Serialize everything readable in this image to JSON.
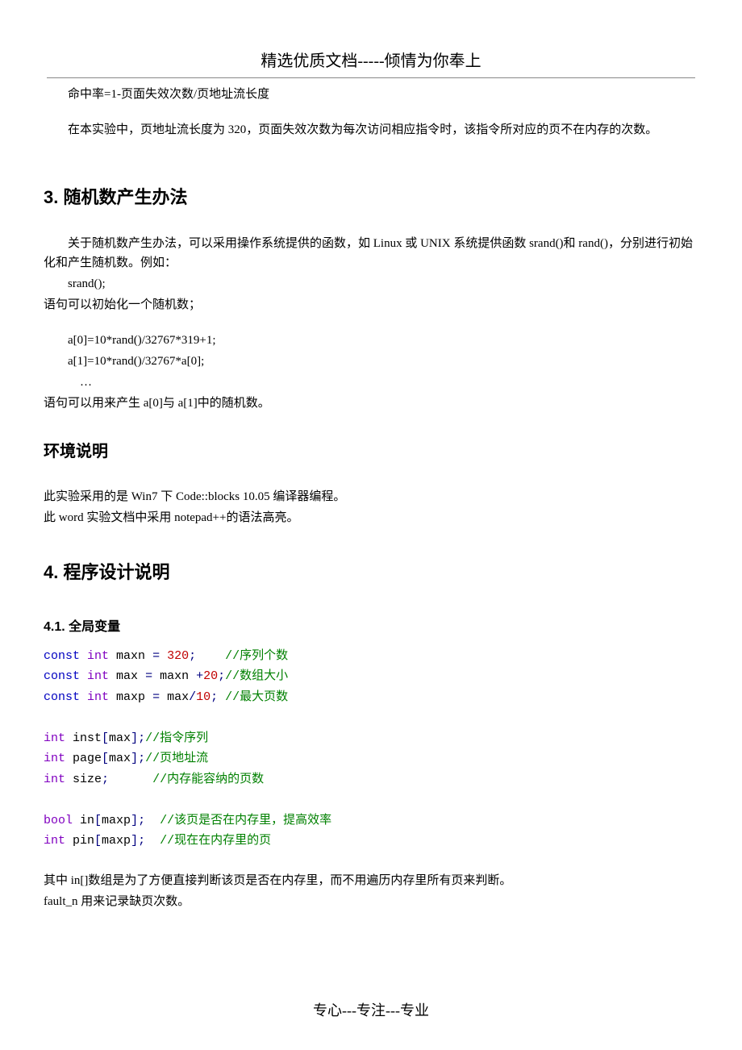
{
  "header": {
    "title": "精选优质文档-----倾情为你奉上"
  },
  "body": {
    "p1": "命中率=1-页面失效次数/页地址流长度",
    "p2": "在本实验中，页地址流长度为 320，页面失效次数为每次访问相应指令时，该指令所对应的页不在内存的次数。",
    "h2_3": "3. 随机数产生办法",
    "p3": "关于随机数产生办法，可以采用操作系统提供的函数，如 Linux 或 UNIX 系统提供函数 srand()和 rand()，分别进行初始化和产生随机数。例如：",
    "p4": "srand();",
    "p5": "语句可以初始化一个随机数；",
    "p6": "a[0]=10*rand()/32767*319+1;",
    "p7": "a[1]=10*rand()/32767*a[0];",
    "p8": "…",
    "p9": "语句可以用来产生 a[0]与 a[1]中的随机数。",
    "h3_env": "环境说明",
    "p10": "此实验采用的是 Win7 下 Code::blocks 10.05 编译器编程。",
    "p11": "此 word 实验文档中采用 notepad++的语法高亮。",
    "h2_4": "4. 程序设计说明",
    "h4_41": "4.1. 全局变量",
    "code": {
      "l1": {
        "kw1": "const",
        "type1": "int",
        "id": " maxn ",
        "op1": "=",
        "sp1": " ",
        "num1": "320",
        "semi": ";",
        "pad": "    ",
        "cmt": "//序列个数"
      },
      "l2": {
        "kw1": "const",
        "type1": "int",
        "id": " max ",
        "op1": "=",
        "sp1": " maxn ",
        "op2": "+",
        "num1": "20",
        "semi": ";",
        "cmt": "//数组大小"
      },
      "l3": {
        "kw1": "const",
        "type1": "int",
        "id": " maxp ",
        "op1": "=",
        "sp1": " max",
        "op2": "/",
        "num1": "10",
        "semi": ";",
        "pad": " ",
        "cmt": "//最大页数"
      },
      "l4": {
        "type1": "int",
        "id": " inst",
        "br1": "[",
        "arr": "max",
        "br2": "]",
        "semi": ";",
        "cmt": "//指令序列"
      },
      "l5": {
        "type1": "int",
        "id": " page",
        "br1": "[",
        "arr": "max",
        "br2": "]",
        "semi": ";",
        "cmt": "//页地址流"
      },
      "l6": {
        "type1": "int",
        "id": " size",
        "semi": ";",
        "pad": "      ",
        "cmt": "//内存能容纳的页数"
      },
      "l7": {
        "type1": "bool",
        "id": " in",
        "br1": "[",
        "arr": "maxp",
        "br2": "]",
        "semi": ";",
        "pad": "  ",
        "cmt": "//该页是否在内存里，提高效率"
      },
      "l8": {
        "type1": "int",
        "id": " pin",
        "br1": "[",
        "arr": "maxp",
        "br2": "]",
        "semi": ";",
        "pad": "  ",
        "cmt": "//现在在内存里的页"
      }
    },
    "p12": "其中 in[]数组是为了方便直接判断该页是否在内存里，而不用遍历内存里所有页来判断。",
    "p13": "fault_n 用来记录缺页次数。"
  },
  "footer": {
    "text": "专心---专注---专业"
  }
}
